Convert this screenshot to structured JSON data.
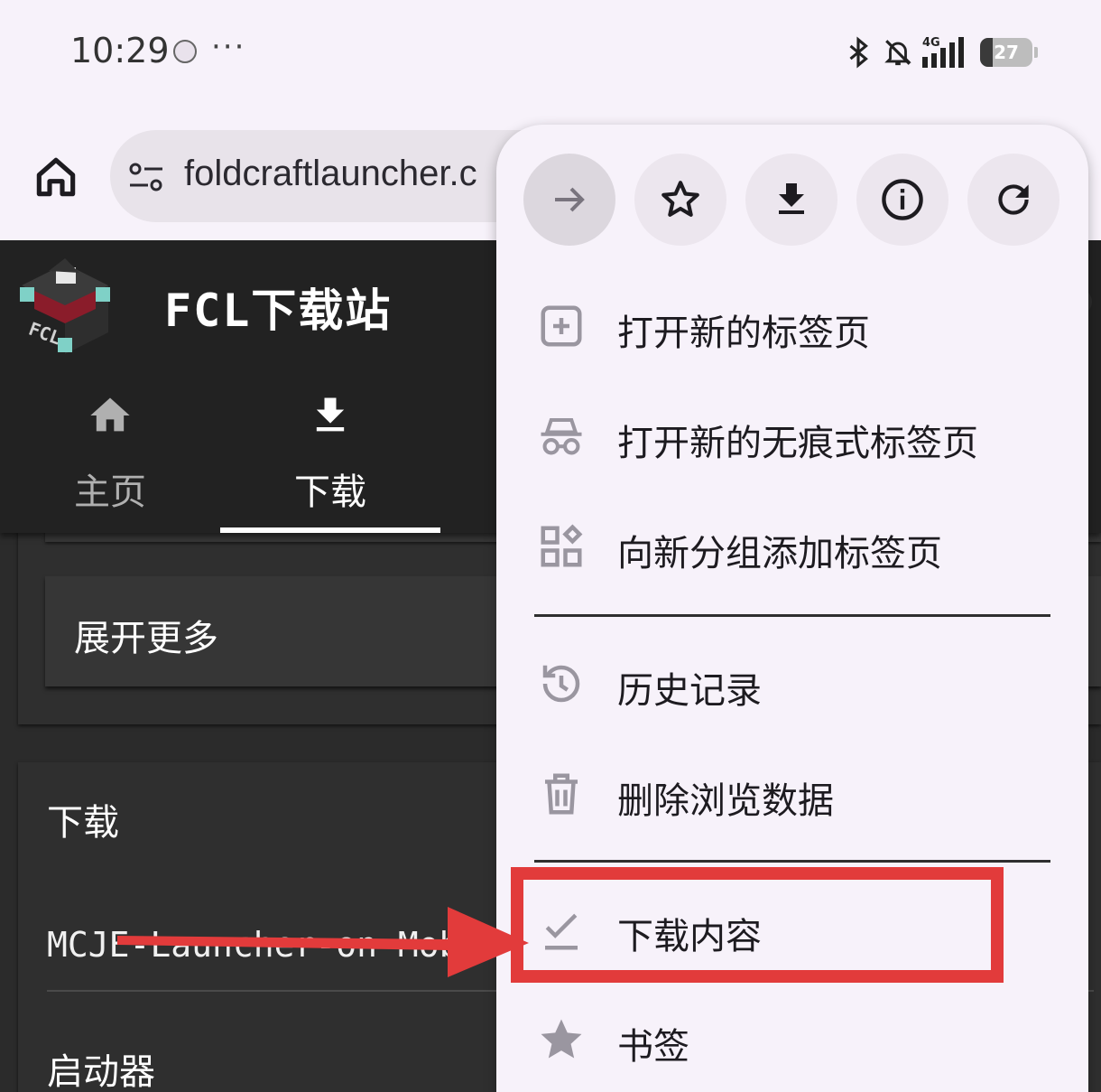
{
  "status_bar": {
    "time": "10:29",
    "more": "···",
    "network_label": "4G",
    "battery": "27"
  },
  "browser": {
    "home_icon": "home-icon",
    "url": "foldcraftlauncher.c"
  },
  "site": {
    "title": "FCL下载站",
    "tabs": [
      {
        "label": "主页",
        "icon": "home-icon"
      },
      {
        "label": "下载",
        "icon": "download-icon"
      }
    ],
    "expand_label": "展开更多",
    "download_section_title": "下载",
    "file_name": "MCJE-Launcher-on Mob",
    "launcher_label": "启动器"
  },
  "menu": {
    "actions": [
      {
        "name": "forward",
        "icon": "arrow-forward-icon"
      },
      {
        "name": "bookmark",
        "icon": "star-outline-icon"
      },
      {
        "name": "download",
        "icon": "download-icon"
      },
      {
        "name": "page-info",
        "icon": "info-icon"
      },
      {
        "name": "reload",
        "icon": "refresh-icon"
      }
    ],
    "items": [
      {
        "label": "打开新的标签页",
        "icon": "new-tab-icon"
      },
      {
        "label": "打开新的无痕式标签页",
        "icon": "incognito-icon"
      },
      {
        "label": "向新分组添加标签页",
        "icon": "tab-group-icon"
      },
      {
        "label": "历史记录",
        "icon": "history-icon"
      },
      {
        "label": "删除浏览数据",
        "icon": "trash-icon"
      },
      {
        "label": "下载内容",
        "icon": "check-download-icon"
      },
      {
        "label": "书签",
        "icon": "star-icon"
      }
    ]
  },
  "annotation": {
    "highlight_color": "#e23b3b",
    "arrow_color": "#e23b3b"
  }
}
